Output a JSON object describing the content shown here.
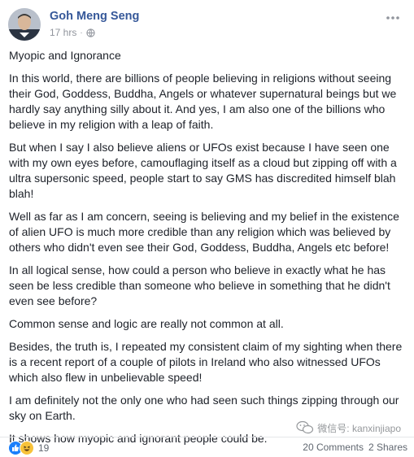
{
  "post": {
    "author": "Goh Meng Seng",
    "timestamp": "17 hrs",
    "separator": "·",
    "privacy_icon": "globe-icon",
    "more_icon": "more-horizontal-icon",
    "paragraphs": [
      "Myopic and Ignorance",
      "In this world, there are billions of people believing in religions without seeing their God, Goddess, Buddha, Angels or whatever supernatural beings but we hardly say anything silly about it. And yes, I am also one of the billions who believe in my religion with a leap of faith.",
      "But when I say I also believe aliens or UFOs exist because I have seen one with my own eyes before, camouflaging itself as a cloud but zipping off with a ultra supersonic speed, people start to say GMS has discredited himself blah blah!",
      "Well as far as I am concern, seeing is believing and my belief in the existence of alien UFO is much more credible than any religion which was believed by others who didn't even see their God, Goddess, Buddha, Angels etc before!",
      "In all logical sense, how could a person who believe in exactly what he has seen be less credible than someone who believe in something that he didn't even see before?",
      "Common sense and logic are really not common at all.",
      "Besides, the truth is, I repeated my consistent claim of my sighting when there is a recent report of a couple of pilots in Ireland who also witnessed UFOs which also flew in unbelievable speed!",
      "I am definitely not the only one who had seen such things zipping through our sky on Earth.",
      "It shows how myopic and ignorant people could be."
    ]
  },
  "footer": {
    "reaction_count": "19",
    "comments": "20 Comments",
    "shares": "2 Shares",
    "reaction_icons": [
      "like-icon",
      "haha-icon"
    ]
  },
  "watermark": {
    "text": "微信号: kanxinjiapo",
    "icon": "wechat-icon"
  },
  "colors": {
    "author_link": "#365899",
    "like_blue": "#1a7ffb",
    "haha_yellow": "#f7c23a",
    "meta_gray": "#90949c"
  }
}
